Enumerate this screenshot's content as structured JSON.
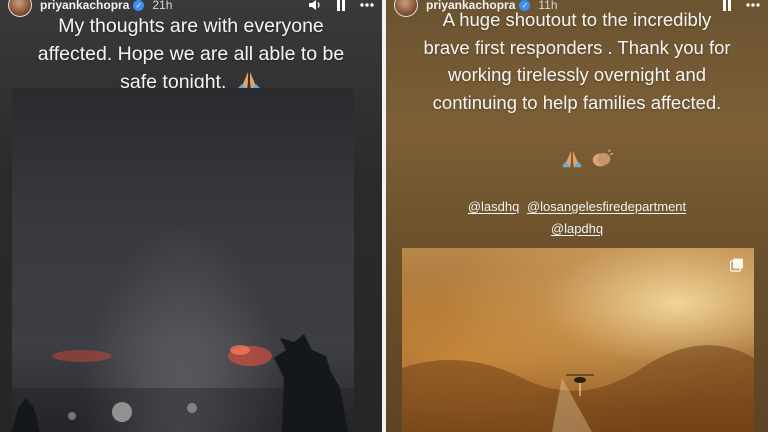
{
  "stories": [
    {
      "username": "priyankachopra",
      "time": "21h",
      "caption_lines": [
        "My thoughts are with everyone",
        "affected. Hope we are all able to be",
        "safe tonight."
      ],
      "emojis": [
        "folded-hands-icon"
      ]
    },
    {
      "username": "priyankachopra",
      "time": "11h",
      "caption_lines": [
        "A huge shoutout to the incredibly",
        "brave first responders . Thank you for",
        "working tirelessly overnight and",
        "continuing to help families affected."
      ],
      "emojis": [
        "folded-hands-icon",
        "clapping-hands-icon"
      ],
      "mentions": [
        "@lasdhq",
        "@losangelesfiredepartment",
        "@lapdhq"
      ]
    }
  ],
  "icons": {
    "verified": "✓",
    "volume": "volume-icon",
    "pause": "pause-icon",
    "more": "more-options-icon",
    "multi_photo": "multiple-photos-icon"
  },
  "colors": {
    "verified_badge": "#3a8ef6",
    "left_background": "#2b2b2b",
    "right_background": "#6b5331"
  }
}
